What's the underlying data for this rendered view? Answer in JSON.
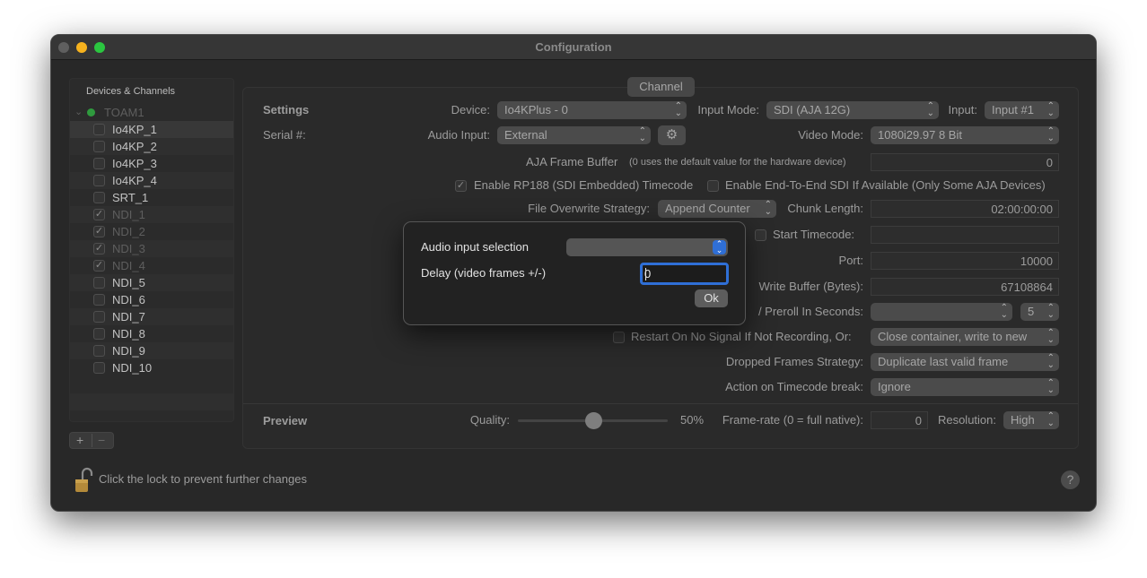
{
  "window": {
    "title": "Configuration"
  },
  "sidebar": {
    "header": "Devices & Channels",
    "group": "TOAM1",
    "items": [
      {
        "label": "Io4KP_1",
        "checked": false
      },
      {
        "label": "Io4KP_2",
        "checked": false
      },
      {
        "label": "Io4KP_3",
        "checked": false
      },
      {
        "label": "Io4KP_4",
        "checked": false
      },
      {
        "label": "SRT_1",
        "checked": false
      },
      {
        "label": "NDI_1",
        "checked": true
      },
      {
        "label": "NDI_2",
        "checked": true
      },
      {
        "label": "NDI_3",
        "checked": true
      },
      {
        "label": "NDI_4",
        "checked": true
      },
      {
        "label": "NDI_5",
        "checked": false
      },
      {
        "label": "NDI_6",
        "checked": false
      },
      {
        "label": "NDI_7",
        "checked": false
      },
      {
        "label": "NDI_8",
        "checked": false
      },
      {
        "label": "NDI_9",
        "checked": false
      },
      {
        "label": "NDI_10",
        "checked": false
      }
    ],
    "add_label": "+",
    "remove_label": "−"
  },
  "channel_tab": "Channel",
  "settings": {
    "heading": "Settings",
    "serial_label": "Serial #:",
    "device_label": "Device:",
    "device_value": "Io4KPlus - 0",
    "input_mode_label": "Input Mode:",
    "input_mode_value": "SDI (AJA 12G)",
    "input_label": "Input:",
    "input_value": "Input #1",
    "audio_input_label": "Audio Input:",
    "audio_input_value": "External",
    "video_mode_label": "Video Mode:",
    "video_mode_value": "1080i29.97 8 Bit",
    "frame_buffer_label": "AJA Frame Buffer",
    "frame_buffer_hint": "(0 uses the default value for the hardware device)",
    "frame_buffer_value": "0",
    "rp188_label": "Enable RP188 (SDI Embedded) Timecode",
    "rp188_checked": true,
    "e2e_label": "Enable End-To-End SDI If Available (Only Some AJA Devices)",
    "e2e_checked": false,
    "overwrite_label": "File Overwrite Strategy:",
    "overwrite_value": "Append Counter",
    "chunk_label": "Chunk Length:",
    "chunk_value": "02:00:00:00",
    "start_tc_label": "Start Timecode:",
    "start_tc_value": "",
    "port_label": "Port:",
    "port_value": "10000",
    "write_buffer_label": "Write Buffer (Bytes):",
    "write_buffer_value": "67108864",
    "preroll_label": "/ Preroll In Seconds:",
    "preroll_value": "",
    "preroll_seconds": "5",
    "restart_label": "Restart On No Signal If Not Recording, Or:",
    "restart_value": "Close container, write to new",
    "dropped_label": "Dropped Frames Strategy:",
    "dropped_value": "Duplicate last valid frame",
    "tc_break_label": "Action on Timecode break:",
    "tc_break_value": "Ignore"
  },
  "preview": {
    "heading": "Preview",
    "quality_label": "Quality:",
    "quality_value": "50%",
    "quality_fraction": 0.5,
    "framerate_label": "Frame-rate (0 = full native):",
    "framerate_value": "0",
    "resolution_label": "Resolution:",
    "resolution_value": "High"
  },
  "footer": {
    "lock_text": "Click the lock to prevent further changes",
    "help_label": "?"
  },
  "dialog": {
    "audio_selection_label": "Audio input selection",
    "audio_selection_value": "",
    "delay_label": "Delay (video frames +/-)",
    "delay_value": "0",
    "ok_label": "Ok"
  },
  "colors": {
    "accent": "#2f6fd6",
    "close": "#5f5f5f",
    "minimize": "#f6b21e",
    "zoom": "#2bc640"
  }
}
